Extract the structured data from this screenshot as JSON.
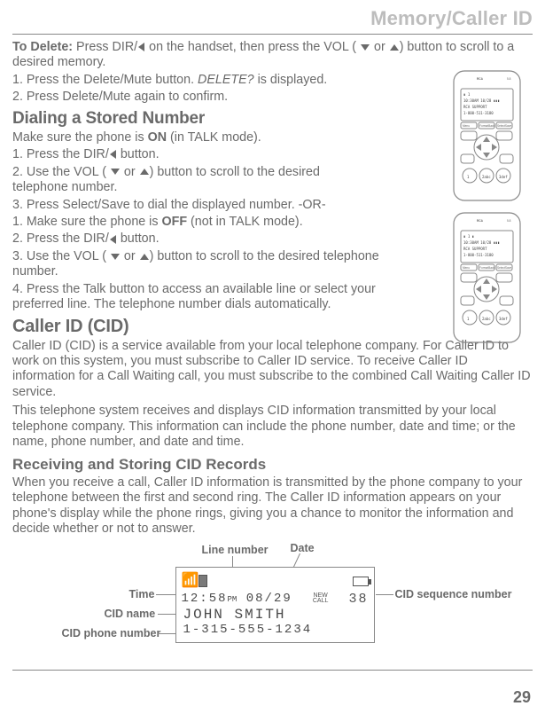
{
  "header": {
    "section": "Memory/Caller ID"
  },
  "delete": {
    "lead": "To Delete:",
    "text1a": " Press DIR/",
    "text1b": " on the handset, then press the VOL ( ",
    "text1c": " or ",
    "text1d": ") button to scroll to a desired memory.",
    "step1a": "1. Press the Delete/Mute button. ",
    "step1_italic": "DELETE?",
    "step1b": " is displayed.",
    "step2": "2. Press Delete/Mute again to confirm."
  },
  "dialing": {
    "title": "Dialing a Stored Number",
    "intro_a": "Make sure the phone is ",
    "intro_on": "ON",
    "intro_b": " (in TALK mode).",
    "s1a": "1. Press the DIR/",
    "s1b": " button.",
    "s2a": "2. Use the VOL ( ",
    "s2b": " or ",
    "s2c": ") button to scroll to the desired telephone number.",
    "s3": "3. Press Select/Save to dial the displayed number.   -OR-",
    "alt1a": "1. Make sure the phone is ",
    "alt1_off": "OFF",
    "alt1b": " (not in TALK mode).",
    "alt2a": "2. Press the DIR/",
    "alt2b": "  button.",
    "alt3a": "3. Use the VOL ( ",
    "alt3b": " or ",
    "alt3c": ") button to scroll to the desired telephone number.",
    "alt4": "4. Press the Talk button to access an available line or select your preferred line. The telephone number dials automatically."
  },
  "cid": {
    "title": "Caller ID (CID)",
    "p1": "Caller ID (CID) is a service available from your local telephone company. For Caller ID to work on this system, you must subscribe to Caller ID service. To receive Caller ID information for a Call Waiting call, you must subscribe to the combined Call Waiting Caller ID service.",
    "p2": "This telephone system receives and displays CID information transmitted by your local telephone company. This information can include the phone number, date and time; or the name, phone number, and date and time."
  },
  "recv": {
    "title": "Receiving and Storing CID Records",
    "p1": "When you receive a call, Caller ID information is transmitted by the phone company to your telephone between the first and second ring. The Caller ID information appears on your phone's display while the phone rings, giving you a chance to monitor the information and decide whether or not to answer."
  },
  "diagram": {
    "labels": {
      "line_number": "Line number",
      "date": "Date",
      "time": "Time",
      "cid_name": "CID name",
      "cid_phone": "CID phone number",
      "cid_seq": "CID sequence number"
    },
    "screen": {
      "time": "12:58",
      "ampm": "PM",
      "date": "08/29",
      "new_call": "NEW CALL",
      "seq": "38",
      "name": "JOHN SMITH",
      "phone": "1-315-555-1234"
    }
  },
  "phone_screen": {
    "line1": "10:30AM 10/28 ▮▮▮",
    "line2": "RCA SUPPORT",
    "line3": "1-800-511-3180",
    "menu": "Menu",
    "fb": "FormatBack",
    "ss": "SelectSave"
  },
  "page_number": "29"
}
